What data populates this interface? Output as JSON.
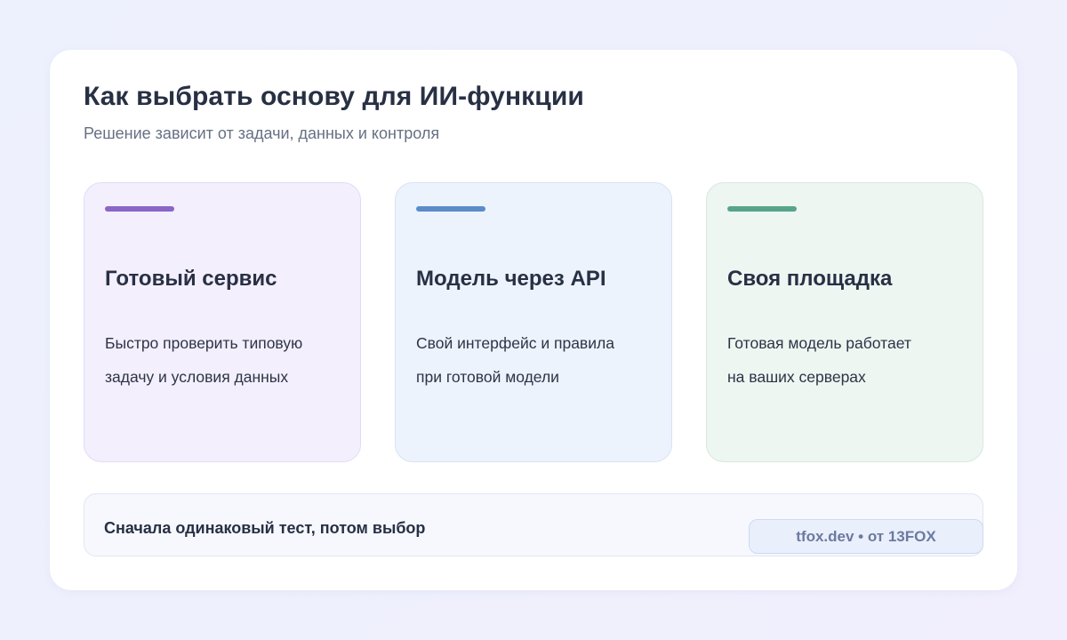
{
  "header": {
    "title": "Как выбрать основу для ИИ-функции",
    "subtitle": "Решение зависит от задачи, данных и контроля"
  },
  "cards": [
    {
      "title": "Готовый сервис",
      "description": "Быстро проверить типовую\nзадачу и условия данных",
      "accent": "#8a66c8",
      "background": "#f3effd",
      "border": "#e2dcf4"
    },
    {
      "title": "Модель через API",
      "description": "Свой интерфейс и правила\nпри готовой модели",
      "accent": "#5b8cc9",
      "background": "#ecf3fd",
      "border": "#d8e3f3"
    },
    {
      "title": "Своя площадка",
      "description": "Готовая модель работает\nна ваших серверах",
      "accent": "#57a48c",
      "background": "#edf6f1",
      "border": "#d8e9e0"
    }
  ],
  "footer": {
    "text": "Сначала одинаковый тест, потом выбор",
    "badge": "tfox.dev • от 13FOX"
  }
}
